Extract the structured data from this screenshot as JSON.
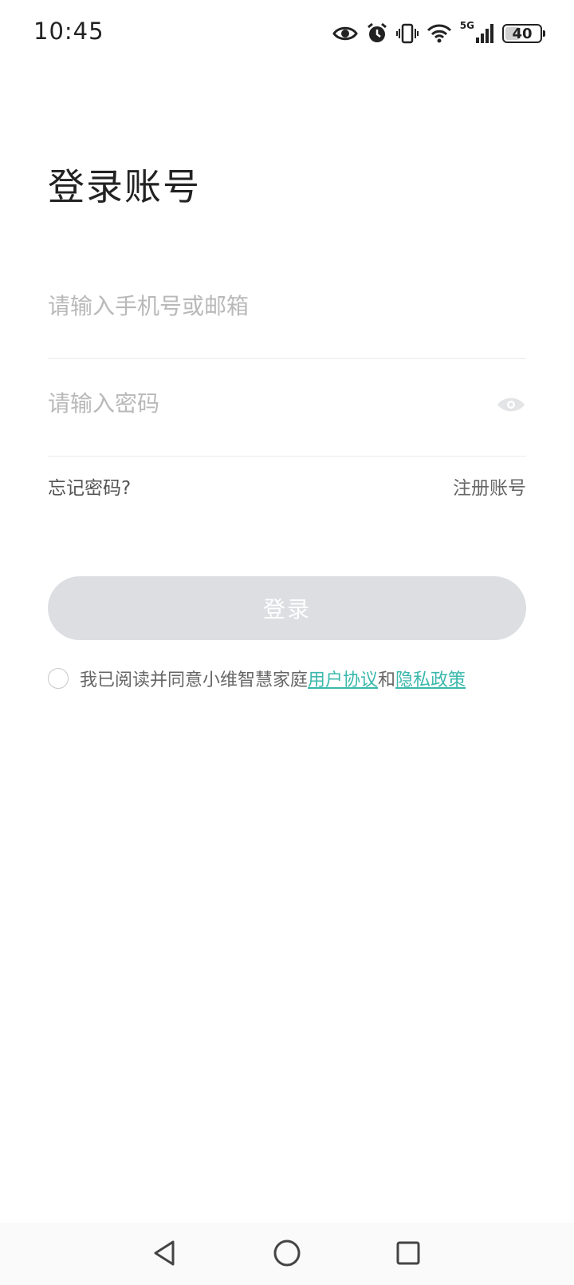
{
  "status_bar": {
    "time": "10:45",
    "network_label": "5G",
    "battery_level": "40",
    "icons": [
      "eye-comfort-icon",
      "alarm-icon",
      "vibrate-icon",
      "wifi-icon",
      "cellular-signal-icon",
      "battery-icon"
    ]
  },
  "page": {
    "title": "登录账号"
  },
  "form": {
    "account_placeholder": "请输入手机号或邮箱",
    "account_value": "",
    "password_placeholder": "请输入密码",
    "password_value": "",
    "forgot_password": "忘记密码?",
    "register": "注册账号",
    "login_button": "登录"
  },
  "agreement": {
    "checked": false,
    "prefix": "我已阅读并同意小维智慧家庭",
    "user_agreement": "用户协议",
    "conjunction": "和",
    "privacy_policy": "隐私政策"
  },
  "colors": {
    "accent": "#3bb8ac",
    "button_disabled": "#dcdee2",
    "placeholder": "#b9b9b9"
  },
  "nav_bar": {
    "icons": [
      "back-icon",
      "home-icon",
      "recent-apps-icon"
    ]
  }
}
